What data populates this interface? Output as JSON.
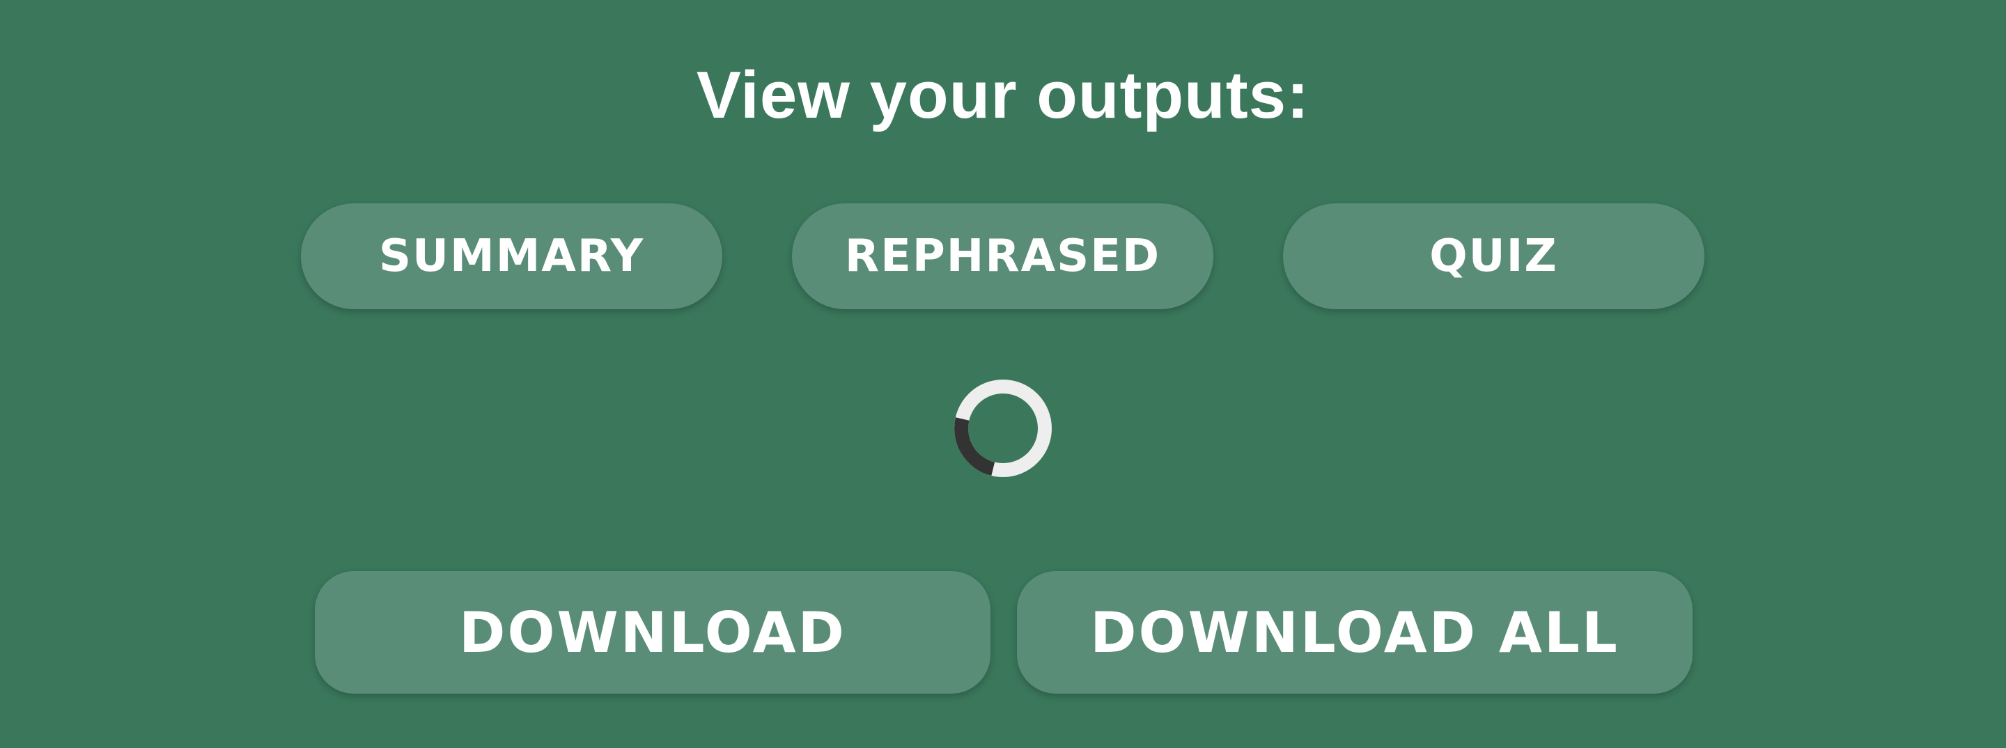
{
  "heading": "View your outputs:",
  "tabs": [
    {
      "label": "SUMMARY"
    },
    {
      "label": "REPHRASED"
    },
    {
      "label": "QUIZ"
    }
  ],
  "loading": {
    "icon": "loading-spinner-icon"
  },
  "actions": {
    "download_label": "DOWNLOAD",
    "download_all_label": "DOWNLOAD ALL"
  },
  "colors": {
    "background": "#3a775b",
    "button": "#5a8d78",
    "text": "#ffffff",
    "spinner_track": "#eeeeee",
    "spinner_arc": "#333333"
  }
}
